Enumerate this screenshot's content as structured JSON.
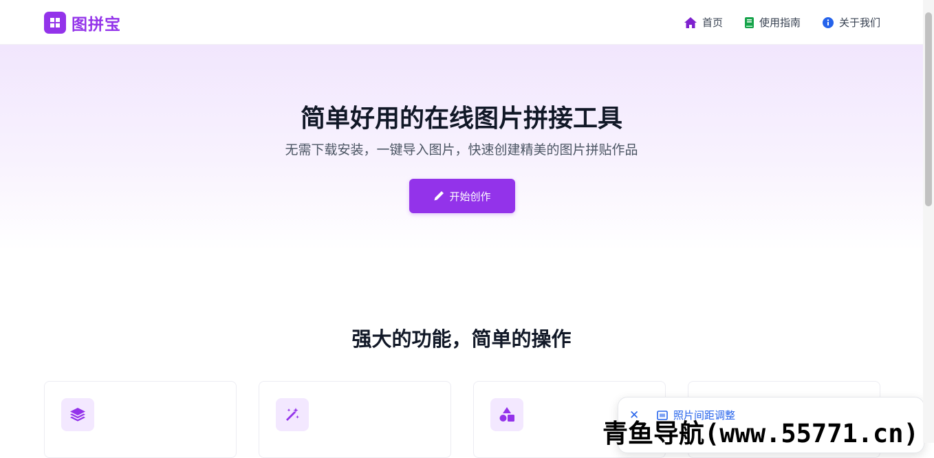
{
  "header": {
    "logo_text": "图拼宝",
    "nav": [
      {
        "label": "首页",
        "icon": "home-icon"
      },
      {
        "label": "使用指南",
        "icon": "book-icon"
      },
      {
        "label": "关于我们",
        "icon": "info-icon"
      }
    ]
  },
  "hero": {
    "title": "简单好用的在线图片拼接工具",
    "subtitle": "无需下载安装，一键导入图片，快速创建精美的图片拼贴作品",
    "cta_label": "开始创作"
  },
  "features": {
    "title": "强大的功能，简单的操作",
    "cards": [
      {
        "icon": "layers-icon"
      },
      {
        "icon": "magic-wand-icon"
      },
      {
        "icon": "shapes-icon"
      },
      {
        "icon": "blank"
      }
    ]
  },
  "toast": {
    "close_label": "✕",
    "text": "照片间距调整"
  },
  "watermark": "青鱼导航(www.55771.cn)",
  "colors": {
    "accent": "#9333ea",
    "accent_light": "#f3e8ff",
    "home_icon": "#7e22ce",
    "book_icon": "#16a34a",
    "info_icon": "#2563eb",
    "toast_text": "#2563eb"
  }
}
